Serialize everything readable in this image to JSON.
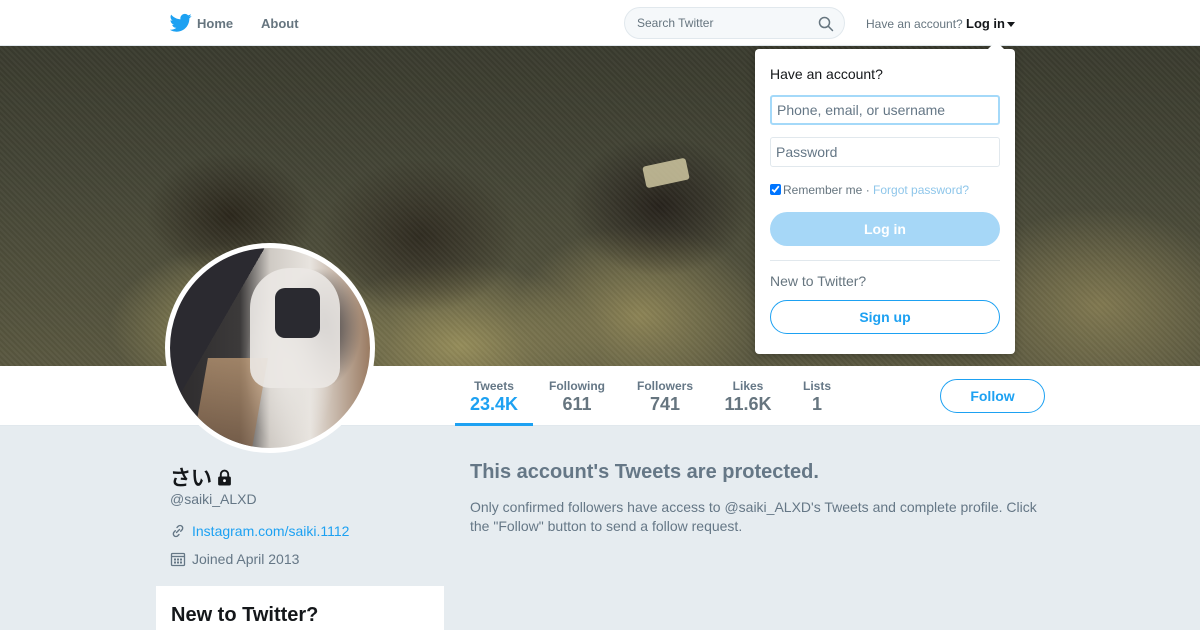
{
  "nav": {
    "logo_icon": "twitter-bird-icon",
    "home_label": "Home",
    "about_label": "About",
    "search_placeholder": "Search Twitter",
    "have_account_text": "Have an account?",
    "login_label": "Log in"
  },
  "colors": {
    "accent": "#1da1f2",
    "page_bg": "#e6ecf0",
    "muted_text": "#657786"
  },
  "stats": [
    {
      "label": "Tweets",
      "value": "23.4K"
    },
    {
      "label": "Following",
      "value": "611"
    },
    {
      "label": "Followers",
      "value": "741"
    },
    {
      "label": "Likes",
      "value": "11.6K"
    },
    {
      "label": "Lists",
      "value": "1"
    }
  ],
  "follow_label": "Follow",
  "profile": {
    "name": "さい",
    "handle": "@saiki_ALXD",
    "url": "Instagram.com/saiki.1112",
    "joined": "Joined April 2013"
  },
  "new_card_title": "New to Twitter?",
  "protected": {
    "title": "This account's Tweets are protected.",
    "body": "Only confirmed followers have access to @saiki_ALXD's Tweets and complete profile. Click the \"Follow\" button to send a follow request."
  },
  "login_dropdown": {
    "heading": "Have an account?",
    "username_placeholder": "Phone, email, or username",
    "password_placeholder": "Password",
    "remember_label": "Remember me",
    "separator": " · ",
    "forgot_label": "Forgot password?",
    "login_button": "Log in",
    "new_to_twitter": "New to Twitter?",
    "signup_button": "Sign up"
  }
}
